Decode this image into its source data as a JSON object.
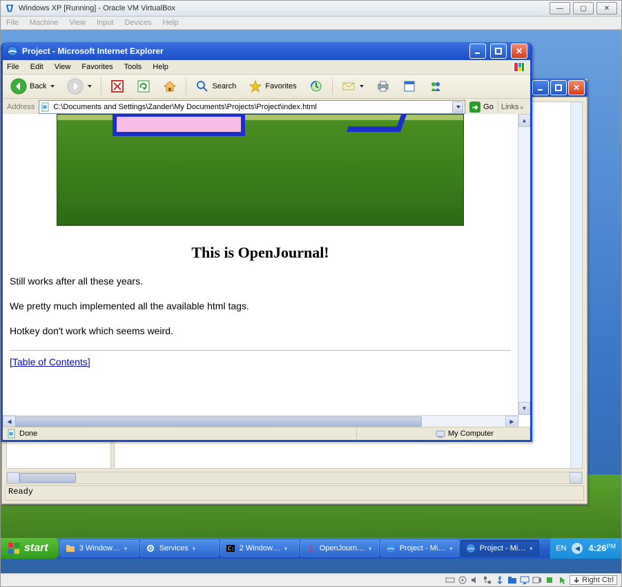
{
  "virtualbox": {
    "title": "Windows XP [Running] - Oracle VM VirtualBox",
    "menu": [
      "File",
      "Machine",
      "View",
      "Input",
      "Devices",
      "Help"
    ],
    "host_key": "Right Ctrl"
  },
  "bg_app": {
    "status": "Ready"
  },
  "ie": {
    "title": "Project - Microsoft Internet Explorer",
    "menu": [
      "File",
      "Edit",
      "View",
      "Favorites",
      "Tools",
      "Help"
    ],
    "toolbar": {
      "back": "Back",
      "search": "Search",
      "favorites": "Favorites"
    },
    "address_label": "Address",
    "address_value": "C:\\Documents and Settings\\Zander\\My Documents\\Projects\\Project\\index.html",
    "go": "Go",
    "links": "Links",
    "status_left": "Done",
    "status_zone": "My Computer"
  },
  "page": {
    "h1": "This is OpenJournal!",
    "p1": "Still works after all these years.",
    "p2": "We pretty much implemented all the available html tags.",
    "p3": "Hotkey don't work which seems weird.",
    "toc": "[Table of Contents]"
  },
  "taskbar": {
    "start": "start",
    "items": [
      {
        "label": "3 Window…",
        "icon": "folder-icon"
      },
      {
        "label": "Services",
        "icon": "gear-icon"
      },
      {
        "label": "2 Window…",
        "icon": "cmd-icon"
      },
      {
        "label": "OpenJourn…",
        "icon": "java-icon"
      },
      {
        "label": "Project - Mi…",
        "icon": "ie-icon"
      },
      {
        "label": "Project - Mi…",
        "icon": "ie-icon",
        "active": true
      }
    ],
    "lang": "EN",
    "time": "4:26",
    "ampm": "PM"
  }
}
